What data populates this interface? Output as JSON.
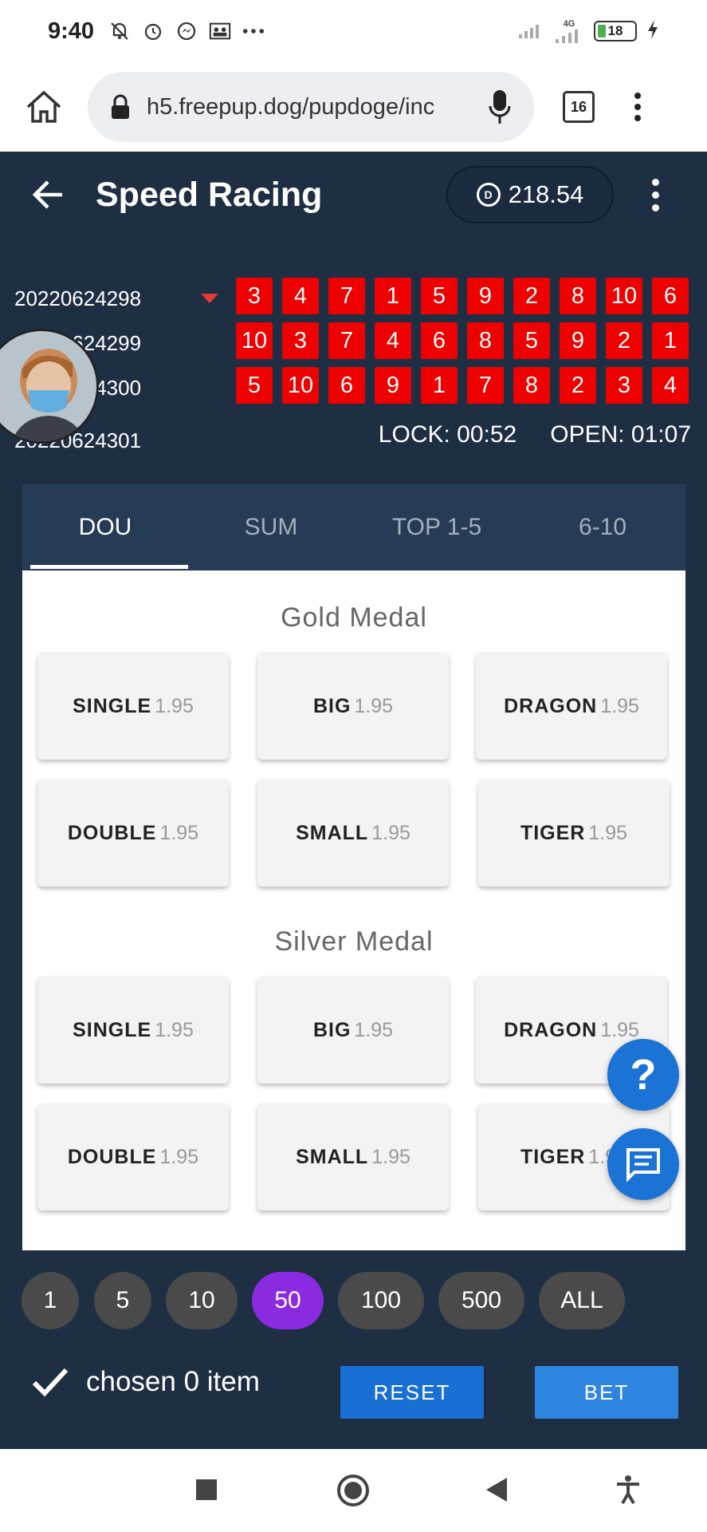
{
  "status_bar": {
    "time": "9:40",
    "battery": "18",
    "network": "4G"
  },
  "browser": {
    "url": "h5.freepup.dog/pupdoge/inc",
    "tab_count": "16"
  },
  "header": {
    "title": "Speed Racing",
    "balance": "218.54"
  },
  "results": [
    {
      "issue": "20220624298",
      "numbers": [
        "3",
        "4",
        "7",
        "1",
        "5",
        "9",
        "2",
        "8",
        "10",
        "6"
      ]
    },
    {
      "issue": "20220624299",
      "numbers": [
        "10",
        "3",
        "7",
        "4",
        "6",
        "8",
        "5",
        "9",
        "2",
        "1"
      ]
    },
    {
      "issue": "20220624300",
      "numbers": [
        "5",
        "10",
        "6",
        "9",
        "1",
        "7",
        "8",
        "2",
        "3",
        "4"
      ]
    }
  ],
  "next_issue": "20220624301",
  "timers": {
    "lock": "LOCK: 00:52",
    "open": "OPEN: 01:07"
  },
  "tabs": [
    {
      "label": "DOU",
      "active": true
    },
    {
      "label": "SUM",
      "active": false
    },
    {
      "label": "TOP 1-5",
      "active": false
    },
    {
      "label": "6-10",
      "active": false
    }
  ],
  "groups": [
    {
      "title": "Gold Medal",
      "options": [
        {
          "label": "SINGLE",
          "odds": "1.95"
        },
        {
          "label": "BIG",
          "odds": "1.95"
        },
        {
          "label": "DRAGON",
          "odds": "1.95"
        },
        {
          "label": "DOUBLE",
          "odds": "1.95"
        },
        {
          "label": "SMALL",
          "odds": "1.95"
        },
        {
          "label": "TIGER",
          "odds": "1.95"
        }
      ]
    },
    {
      "title": "Silver Medal",
      "options": [
        {
          "label": "SINGLE",
          "odds": "1.95"
        },
        {
          "label": "BIG",
          "odds": "1.95"
        },
        {
          "label": "DRAGON",
          "odds": "1.95"
        },
        {
          "label": "DOUBLE",
          "odds": "1.95"
        },
        {
          "label": "SMALL",
          "odds": "1.95"
        },
        {
          "label": "TIGER",
          "odds": "1.95"
        }
      ]
    }
  ],
  "chips": [
    {
      "label": "1",
      "active": false
    },
    {
      "label": "5",
      "active": false
    },
    {
      "label": "10",
      "active": false
    },
    {
      "label": "50",
      "active": true
    },
    {
      "label": "100",
      "active": false
    },
    {
      "label": "500",
      "active": false
    },
    {
      "label": "ALL",
      "active": false
    }
  ],
  "actions": {
    "chosen": "chosen 0 item",
    "reset": "RESET",
    "bet": "BET"
  },
  "colors": {
    "header_bg": "#1e2f44",
    "ball_red": "#ef0000",
    "chip_active": "#8a2be2",
    "button_blue": "#1a6fd4"
  },
  "icons": {
    "fab_help": "?"
  }
}
